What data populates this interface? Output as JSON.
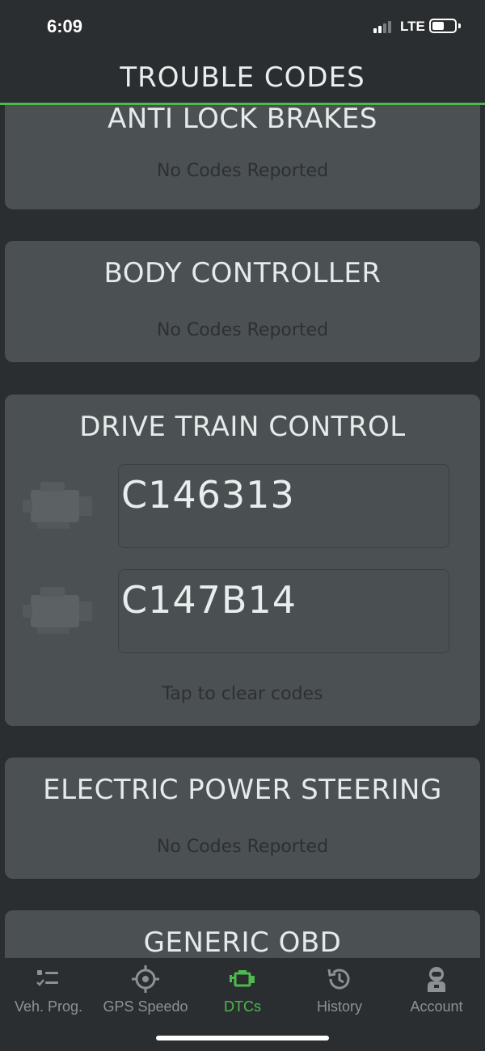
{
  "status_bar": {
    "time": "6:09",
    "network": "LTE"
  },
  "header": {
    "title": "TROUBLE CODES",
    "accent_color": "#4fb84e"
  },
  "sections": [
    {
      "title": "ANTI LOCK BRAKES",
      "note": "No Codes Reported"
    },
    {
      "title": "BODY CONTROLLER",
      "note": "No Codes Reported"
    },
    {
      "title": "DRIVE TRAIN CONTROL",
      "codes": [
        "C146313",
        "C147B14"
      ],
      "note": "Tap to clear codes"
    },
    {
      "title": "ELECTRIC POWER STEERING",
      "note": "No Codes Reported"
    },
    {
      "title": "GENERIC OBD"
    }
  ],
  "tabbar": {
    "items": [
      {
        "label": "Veh. Prog.",
        "icon": "checklist-icon"
      },
      {
        "label": "GPS Speedo",
        "icon": "target-icon"
      },
      {
        "label": "DTCs",
        "icon": "engine-icon",
        "active": true
      },
      {
        "label": "History",
        "icon": "history-icon"
      },
      {
        "label": "Account",
        "icon": "astronaut-icon"
      }
    ]
  }
}
